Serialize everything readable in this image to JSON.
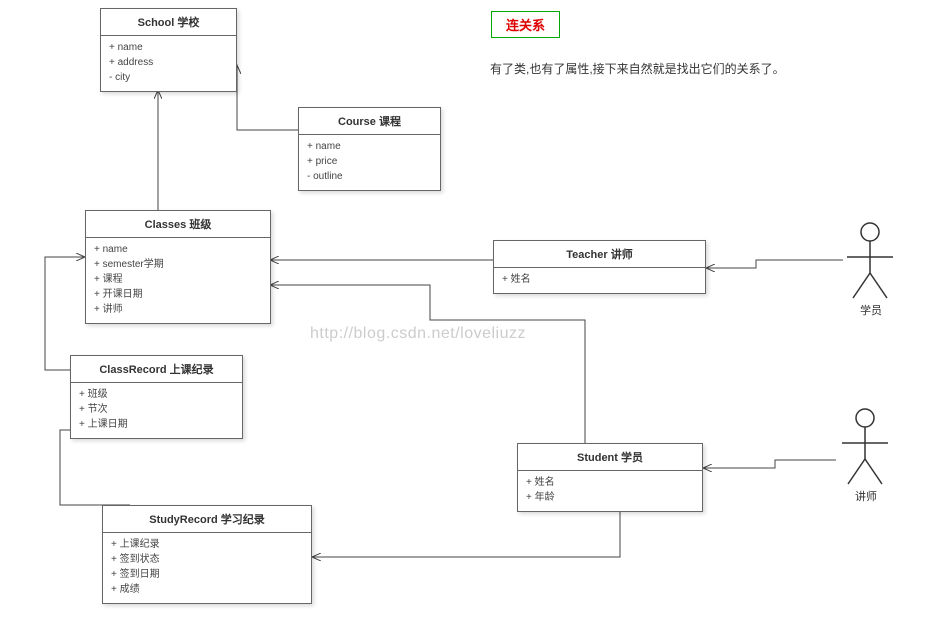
{
  "header": {
    "section_label": "连关系",
    "description": "有了类,也有了属性,接下来自然就是找出它们的关系了。"
  },
  "watermark": "http://blog.csdn.net/loveliuzz",
  "classes": {
    "school": {
      "title": "School 学校",
      "attrs": [
        "+ name",
        "+ address",
        "- city"
      ]
    },
    "course": {
      "title": "Course 课程",
      "attrs": [
        "+ name",
        "+ price",
        "- outline"
      ]
    },
    "classes": {
      "title": "Classes 班级",
      "attrs": [
        "+ name",
        "+ semester学期",
        "+ 课程",
        "+ 开课日期",
        "+ 讲师"
      ]
    },
    "teacher": {
      "title": "Teacher 讲师",
      "attrs": [
        "+ 姓名"
      ]
    },
    "classrecord": {
      "title": "ClassRecord 上课纪录",
      "attrs": [
        "+ 班级",
        "+ 节次",
        "+ 上课日期"
      ]
    },
    "student": {
      "title": "Student 学员",
      "attrs": [
        "+ 姓名",
        "+ 年龄"
      ]
    },
    "studyrecord": {
      "title": "StudyRecord 学习纪录",
      "attrs": [
        "+ 上课纪录",
        "+ 签到状态",
        "+ 签到日期",
        "+ 成绩"
      ]
    }
  },
  "actors": {
    "topActor": "学员",
    "bottomActor": "讲师"
  }
}
